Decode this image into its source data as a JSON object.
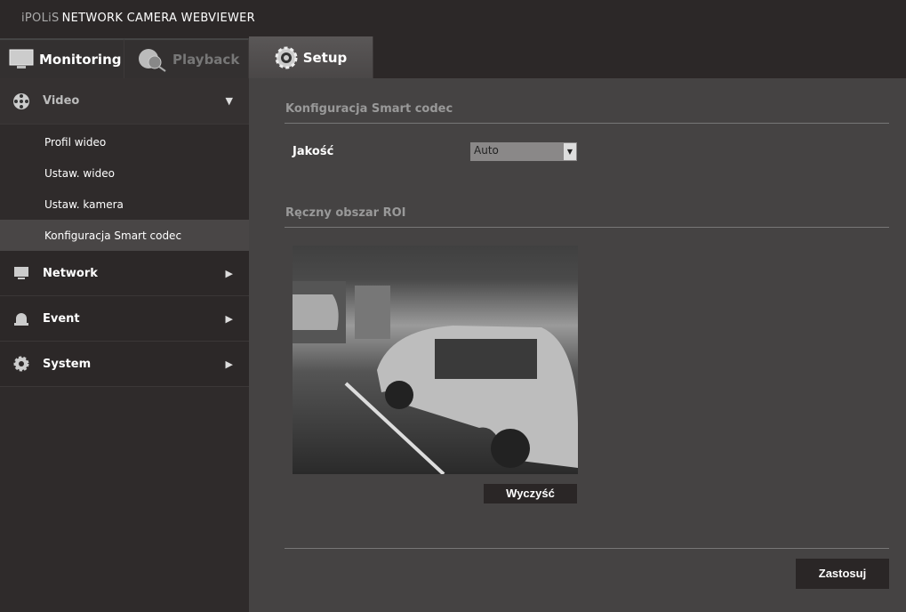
{
  "header": {
    "brand_prefix": "iPOLiS",
    "title": "NETWORK CAMERA WEBVIEWER"
  },
  "tabs": [
    {
      "label": "Monitoring",
      "icon": "monitor-icon"
    },
    {
      "label": "Playback",
      "icon": "film-search-icon"
    },
    {
      "label": "Setup",
      "icon": "gear-icon",
      "active": true
    }
  ],
  "sidebar": {
    "video": {
      "label": "Video",
      "items": [
        "Profil wideo",
        "Ustaw. wideo",
        "Ustaw. kamera",
        "Konfiguracja Smart codec"
      ],
      "active": "Konfiguracja Smart codec"
    },
    "sections": [
      {
        "label": "Network",
        "icon": "monitor-icon"
      },
      {
        "label": "Event",
        "icon": "alarm-icon"
      },
      {
        "label": "System",
        "icon": "gear-icon"
      }
    ]
  },
  "main": {
    "section1_title": "Konfiguracja Smart codec",
    "quality_label": "Jakość",
    "quality_value": "Auto",
    "section2_title": "Ręczny obszar ROI",
    "clear_button": "Wyczyść",
    "apply_button": "Zastosuj"
  }
}
